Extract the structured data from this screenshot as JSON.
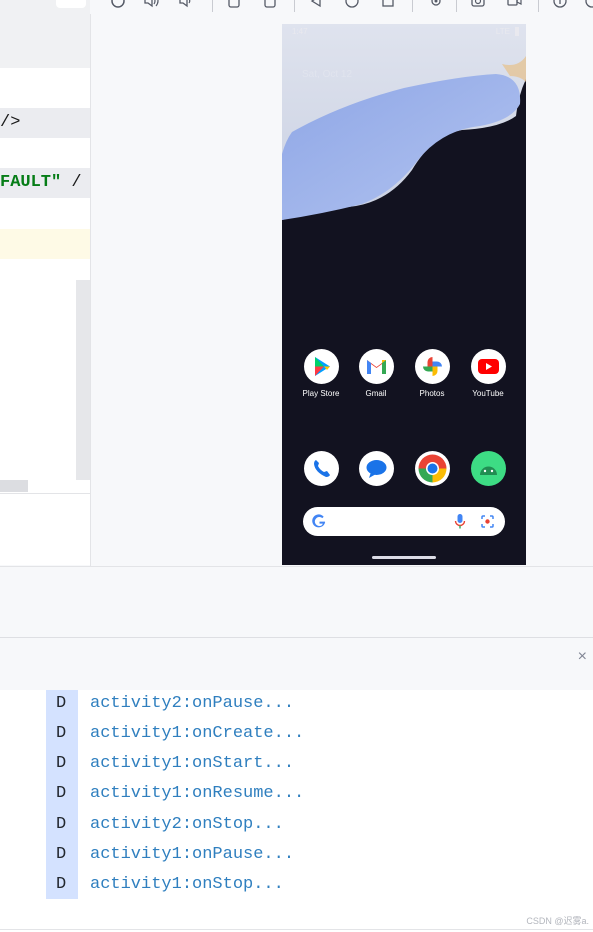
{
  "editor": {
    "line1": "/>",
    "line2_string": "FAULT\"",
    "line2_rest": " /"
  },
  "device": {
    "time": "1:47",
    "status_right": "LTE",
    "date": "Sat, Oct 12",
    "apps_row1": [
      {
        "label": "Play Store"
      },
      {
        "label": "Gmail"
      },
      {
        "label": "Photos"
      },
      {
        "label": "YouTube"
      }
    ]
  },
  "logcat": {
    "close_glyph": "×",
    "rows": [
      {
        "level": "D",
        "message": "activity2:onPause..."
      },
      {
        "level": "D",
        "message": "activity1:onCreate..."
      },
      {
        "level": "D",
        "message": "activity1:onStart..."
      },
      {
        "level": "D",
        "message": "activity1:onResume..."
      },
      {
        "level": "D",
        "message": "activity2:onStop..."
      },
      {
        "level": "D",
        "message": "activity1:onPause..."
      },
      {
        "level": "D",
        "message": "activity1:onStop..."
      }
    ]
  },
  "watermark": "CSDN @迟雾a.",
  "colors": {
    "log_message": "#2f7fbf",
    "level_column": "#d4e2ff",
    "xml_string": "#067d17",
    "device_bg": "#121220"
  },
  "icons": [
    "run-icon",
    "sound-up-icon",
    "sound-down-icon",
    "rotate-left-icon",
    "rotate-right-icon",
    "back-icon",
    "home-icon",
    "overview-icon",
    "settings-icon",
    "screenshot-icon",
    "screenrecord-icon",
    "help-icon"
  ]
}
